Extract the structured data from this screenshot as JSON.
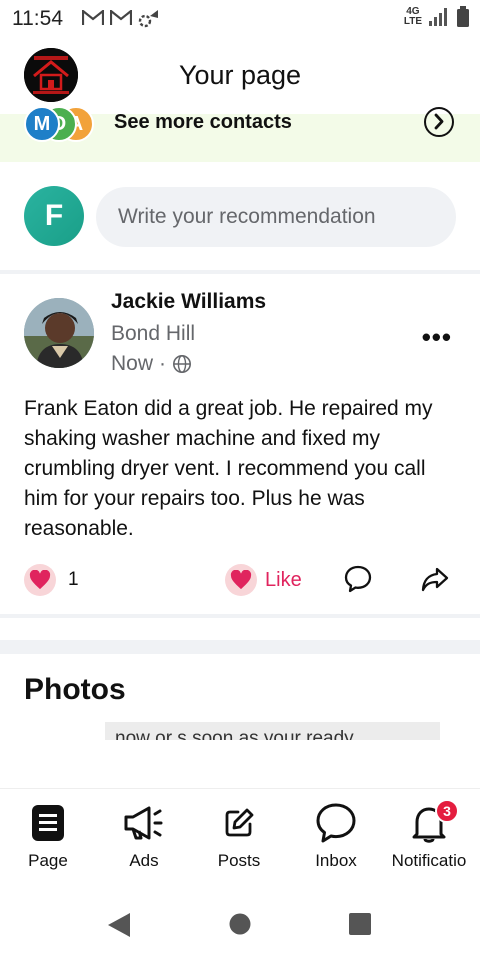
{
  "status_bar": {
    "time": "11:54",
    "network_label_top": "4G",
    "network_label_bottom": "LTE"
  },
  "header": {
    "title": "Your page"
  },
  "contacts": {
    "label": "See more contacts",
    "avatars": [
      "M",
      "D",
      "A"
    ]
  },
  "compose": {
    "avatar_letter": "F",
    "placeholder": "Write your recommendation"
  },
  "post": {
    "author": "Jackie Williams",
    "location": "Bond Hill",
    "time": "Now",
    "separator": "·",
    "text": "Frank Eaton did a great job. He repaired my shaking washer machine and fixed my crumbling dryer vent. I recommend you call him for your repairs too. Plus he was reasonable.",
    "reaction_count": "1",
    "like_label": "Like",
    "more_label": "•••"
  },
  "photos": {
    "title": "Photos",
    "snippet": "now or s soon as your ready"
  },
  "tabs": [
    {
      "label": "Page",
      "icon": "page-icon"
    },
    {
      "label": "Ads",
      "icon": "megaphone-icon"
    },
    {
      "label": "Posts",
      "icon": "edit-icon"
    },
    {
      "label": "Inbox",
      "icon": "chat-bubble-icon"
    },
    {
      "label": "Notificatio",
      "icon": "bell-icon",
      "badge": "3"
    }
  ],
  "colors": {
    "accent_red": "#e0245e",
    "badge_red": "#e41e3f",
    "contacts_bg": "#f3fbe8",
    "compose_avatar": "#1fa892"
  }
}
